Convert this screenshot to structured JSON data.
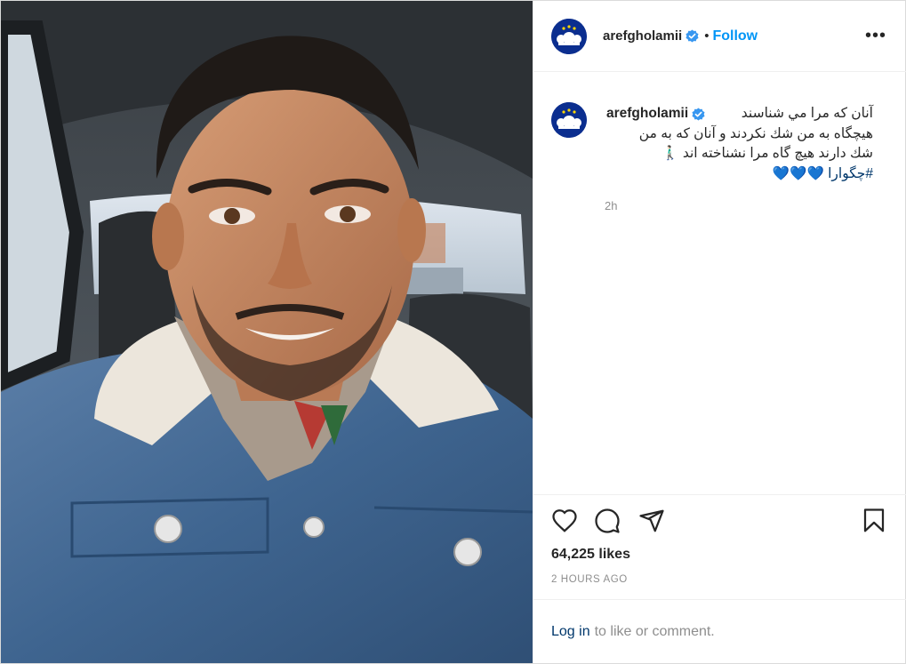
{
  "colors": {
    "follow_blue": "#0095f6",
    "link_navy": "#00376b",
    "secondary_text": "#8e8e8e",
    "verified_blue": "#3897f0",
    "heart_teal": "#26b6bd"
  },
  "header": {
    "username": "arefgholamii",
    "verified_icon": "verified-badge-icon",
    "separator": "•",
    "follow_label": "Follow",
    "more_icon": "more-options-icon",
    "more_label": "•••"
  },
  "comment": {
    "username": "arefgholamii",
    "caption_lines": [
      "آنان که مرا مي شناسند",
      "هیچگاه به من شك نكردند و آنان که به من",
      "شك دارند هیچ گاه مرا نشناخته اند 🚶🏻‍♂️"
    ],
    "hashtag": "#چگوارا",
    "hearts": "💙💙💙",
    "time": "2h"
  },
  "actions": {
    "like_icon": "heart-icon",
    "comment_icon": "comment-icon",
    "share_icon": "share-icon",
    "save_icon": "bookmark-icon"
  },
  "likes": "64,225 likes",
  "posted": "2 HOURS AGO",
  "login": {
    "link": "Log in",
    "rest": "to like or comment."
  }
}
